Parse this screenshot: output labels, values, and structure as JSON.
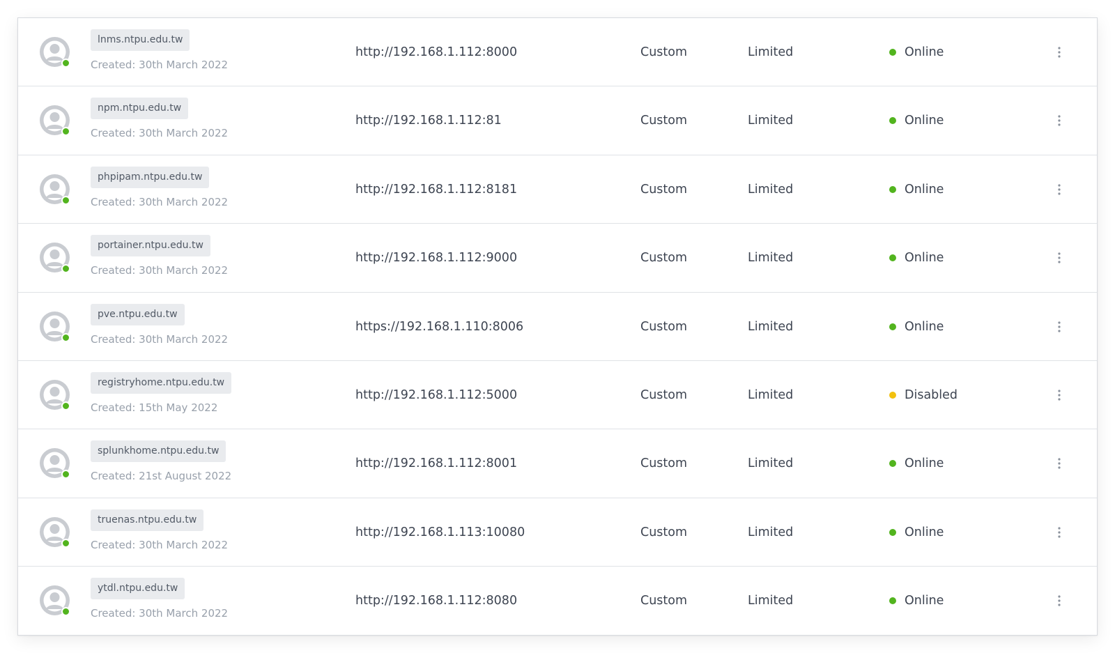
{
  "colors": {
    "online": "#52b41e",
    "disabled": "#f2c10f"
  },
  "proxy_hosts": [
    {
      "host": "lnms.ntpu.edu.tw",
      "created": "Created: 30th March 2022",
      "forward": "http://192.168.1.112:8000",
      "ssl": "Custom",
      "access": "Limited",
      "status": "Online",
      "status_color": "#52b41e",
      "icon": "user-avatar-icon"
    },
    {
      "host": "npm.ntpu.edu.tw",
      "created": "Created: 30th March 2022",
      "forward": "http://192.168.1.112:81",
      "ssl": "Custom",
      "access": "Limited",
      "status": "Online",
      "status_color": "#52b41e",
      "icon": "user-avatar-icon"
    },
    {
      "host": "phpipam.ntpu.edu.tw",
      "created": "Created: 30th March 2022",
      "forward": "http://192.168.1.112:8181",
      "ssl": "Custom",
      "access": "Limited",
      "status": "Online",
      "status_color": "#52b41e",
      "icon": "user-avatar-icon"
    },
    {
      "host": "portainer.ntpu.edu.tw",
      "created": "Created: 30th March 2022",
      "forward": "http://192.168.1.112:9000",
      "ssl": "Custom",
      "access": "Limited",
      "status": "Online",
      "status_color": "#52b41e",
      "icon": "user-avatar-icon"
    },
    {
      "host": "pve.ntpu.edu.tw",
      "created": "Created: 30th March 2022",
      "forward": "https://192.168.1.110:8006",
      "ssl": "Custom",
      "access": "Limited",
      "status": "Online",
      "status_color": "#52b41e",
      "icon": "user-avatar-icon"
    },
    {
      "host": "registryhome.ntpu.edu.tw",
      "created": "Created: 15th May 2022",
      "forward": "http://192.168.1.112:5000",
      "ssl": "Custom",
      "access": "Limited",
      "status": "Disabled",
      "status_color": "#f2c10f",
      "icon": "user-avatar-icon"
    },
    {
      "host": "splunkhome.ntpu.edu.tw",
      "created": "Created: 21st August 2022",
      "forward": "http://192.168.1.112:8001",
      "ssl": "Custom",
      "access": "Limited",
      "status": "Online",
      "status_color": "#52b41e",
      "icon": "user-avatar-icon"
    },
    {
      "host": "truenas.ntpu.edu.tw",
      "created": "Created: 30th March 2022",
      "forward": "http://192.168.1.113:10080",
      "ssl": "Custom",
      "access": "Limited",
      "status": "Online",
      "status_color": "#52b41e",
      "icon": "user-avatar-icon"
    },
    {
      "host": "ytdl.ntpu.edu.tw",
      "created": "Created: 30th March 2022",
      "forward": "http://192.168.1.112:8080",
      "ssl": "Custom",
      "access": "Limited",
      "status": "Online",
      "status_color": "#52b41e",
      "icon": "user-avatar-icon"
    }
  ]
}
